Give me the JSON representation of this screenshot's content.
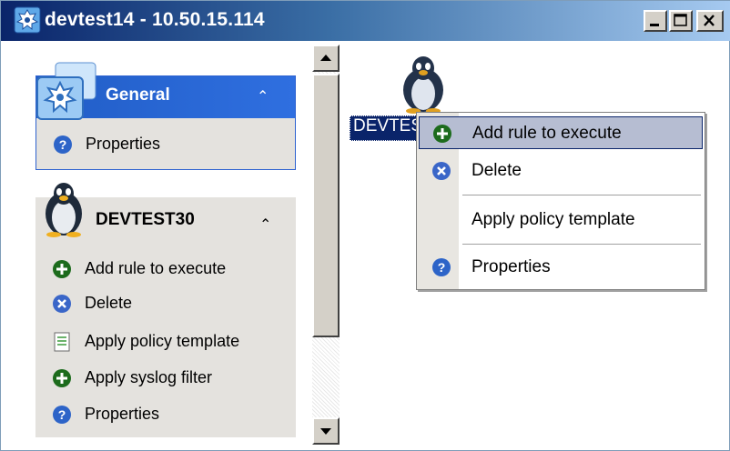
{
  "window": {
    "title": "devtest14 - 10.50.15.114",
    "app_icon": "network-gear-icon",
    "controls": [
      "minimize-icon",
      "maximize-icon",
      "close-icon"
    ]
  },
  "left_pane": {
    "general": {
      "header": "General",
      "collapse_icon": "double-chevron-up-icon",
      "items": [
        {
          "label": "Properties",
          "icon": "help-icon"
        }
      ]
    },
    "devtest30": {
      "header": "DEVTEST30",
      "collapse_icon": "double-chevron-up-icon",
      "items": [
        {
          "label": "Add rule to execute",
          "icon": "add-icon"
        },
        {
          "label": "Delete",
          "icon": "delete-icon"
        },
        {
          "label": "Apply policy template",
          "icon": "document-icon"
        },
        {
          "label": "Apply syslog filter",
          "icon": "add-icon"
        },
        {
          "label": "Properties",
          "icon": "help-icon"
        }
      ]
    }
  },
  "canvas": {
    "node_label": "DEVTEST30",
    "node_icon": "linux-penguin-icon"
  },
  "context_menu": {
    "items": [
      {
        "label": "Add rule to execute",
        "icon": "add-icon",
        "highlighted": true
      },
      {
        "label": "Delete",
        "icon": "delete-icon"
      },
      {
        "label": "Apply policy template",
        "icon": ""
      },
      {
        "label": "Properties",
        "icon": "help-icon"
      }
    ]
  },
  "colors": {
    "title_start": "#0a246a",
    "title_end": "#a6caf0",
    "general_header": "#215dc6",
    "panel_bg": "#e4e2de",
    "menu_highlight": "#b6bdd2"
  }
}
